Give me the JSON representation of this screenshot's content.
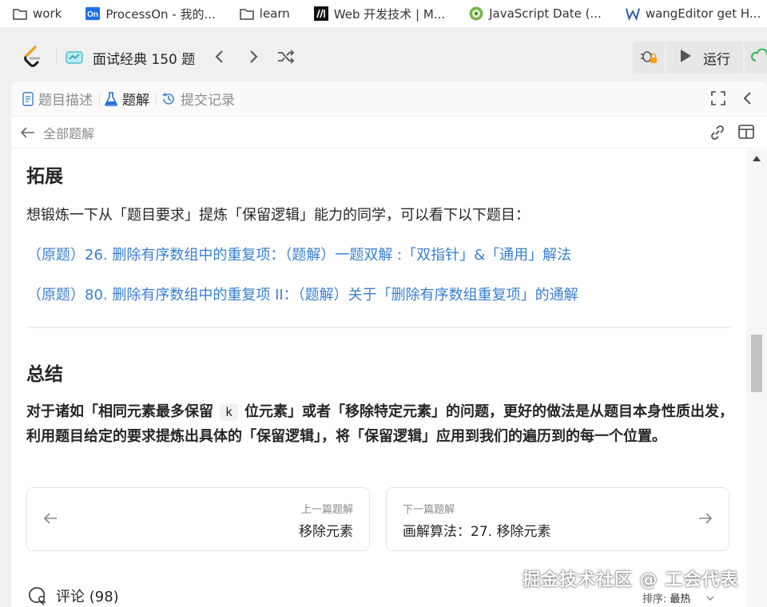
{
  "bookmarks": [
    {
      "label": "work",
      "icon": "folder-icon"
    },
    {
      "label": "ProcessOn - 我的...",
      "icon": "processon-icon"
    },
    {
      "label": "learn",
      "icon": "folder-icon"
    },
    {
      "label": "Web 开发技术 | M...",
      "icon": "mdn-icon"
    },
    {
      "label": "JavaScript Date (...",
      "icon": "javascript-site-icon"
    },
    {
      "label": "wangEditor get H...",
      "icon": "wangeditor-icon"
    }
  ],
  "topnav": {
    "list_label": "面试经典 150 题",
    "run_label": "运行"
  },
  "tabs": [
    {
      "label": "题目描述",
      "icon": "description-icon",
      "active": false
    },
    {
      "label": "题解",
      "icon": "flask-icon",
      "active": true
    },
    {
      "label": "提交记录",
      "icon": "history-icon",
      "active": false
    }
  ],
  "subbar": {
    "back_label": "全部题解"
  },
  "article": {
    "heading_expand": "拓展",
    "expand_text": "想锻炼一下从「题目要求」提炼「保留逻辑」能力的同学，可以看下以下题目：",
    "links": [
      "（原题）26. 删除有序数组中的重复项：（题解）一题双解 :「双指针」&「通用」解法",
      "（原题）80. 删除有序数组中的重复项 II：（题解）关于「删除有序数组重复项」的通解"
    ],
    "heading_summary": "总结",
    "summary_part1": "对于诸如「相同元素最多保留",
    "summary_code": "k",
    "summary_part2": "位元素」或者「移除特定元素」的问题，更好的做法是从题目本身性质出发，利用题目给定的要求提炼出具体的「保留逻辑」，将「保留逻辑」应用到我们的遍历到的每一个位置。"
  },
  "prev": {
    "caption": "上一篇题解",
    "title": "移除元素"
  },
  "next": {
    "caption": "下一篇题解",
    "title": "画解算法：27. 移除元素"
  },
  "comments": {
    "label": "评论 (98)"
  },
  "sort": {
    "label": "排序:",
    "value": "最热"
  },
  "watermark": "掘金技术社区 @ 工会代表",
  "colors": {
    "link": "#3a7fd0",
    "panel_bg": "#ffffff",
    "page_bg": "#f0f0f0",
    "run_green": "#2db55d"
  }
}
